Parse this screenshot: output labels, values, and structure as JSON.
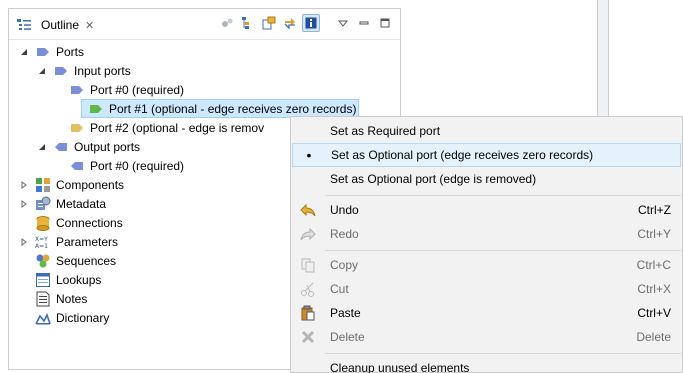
{
  "outline": {
    "tab_title": "Outline",
    "tab_close": "✕",
    "tree": [
      {
        "label": "Ports"
      },
      {
        "label": "Input ports"
      },
      {
        "label": "Port #0 (required)"
      },
      {
        "label": "Port #1 (optional - edge receives zero records)"
      },
      {
        "label": "Port #2 (optional - edge is remov"
      },
      {
        "label": "Output ports"
      },
      {
        "label": "Port #0 (required)"
      },
      {
        "label": "Components"
      },
      {
        "label": "Metadata"
      },
      {
        "label": "Connections"
      },
      {
        "label": "Parameters"
      },
      {
        "label": "Sequences"
      },
      {
        "label": "Lookups"
      },
      {
        "label": "Notes"
      },
      {
        "label": "Dictionary"
      }
    ]
  },
  "context_menu": {
    "items": [
      {
        "label": "Set as Required port",
        "shortcut": ""
      },
      {
        "label": "Set as Optional port (edge receives zero records)",
        "shortcut": ""
      },
      {
        "label": "Set as Optional port (edge is removed)",
        "shortcut": ""
      },
      {
        "label": "Undo",
        "shortcut": "Ctrl+Z"
      },
      {
        "label": "Redo",
        "shortcut": "Ctrl+Y"
      },
      {
        "label": "Copy",
        "shortcut": "Ctrl+C"
      },
      {
        "label": "Cut",
        "shortcut": "Ctrl+X"
      },
      {
        "label": "Paste",
        "shortcut": "Ctrl+V"
      },
      {
        "label": "Delete",
        "shortcut": "Delete"
      },
      {
        "label": "Cleanup unused elements",
        "shortcut": ""
      }
    ],
    "checked_mark": "•"
  },
  "colors": {
    "selection_bg": "#cde8ff",
    "menu_hover_bg": "#e5f1fb",
    "port_input_green": "#5fb84a",
    "port_input_blue": "#7b8fd6",
    "port_input_yellow": "#e0c060"
  }
}
